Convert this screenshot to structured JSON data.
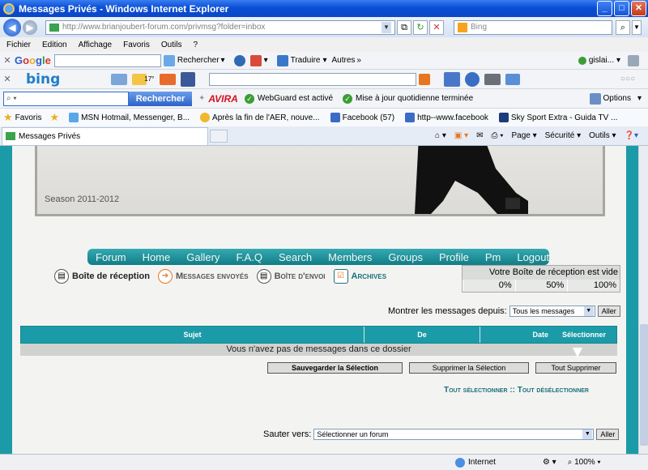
{
  "window": {
    "title": "Messages Privés - Windows Internet Explorer"
  },
  "address": {
    "url": "http://www.brianjoubert-forum.com/privmsg?folder=inbox",
    "search_placeholder": "Bing"
  },
  "menu": [
    "Fichier",
    "Edition",
    "Affichage",
    "Favoris",
    "Outils",
    "?"
  ],
  "google_toolbar": {
    "logo": "Google",
    "search_label": "Rechercher",
    "translate_label": "Traduire",
    "more_label": "Autres",
    "user": "gislai..."
  },
  "bing_toolbar": {
    "logo": "bing",
    "weather": "17°"
  },
  "avira_toolbar": {
    "search_button": "Rechercher",
    "brand": "AVIRA",
    "webguard": "WebGuard est activé",
    "update": "Mise à jour quotidienne terminée",
    "options": "Options"
  },
  "favorites": {
    "label": "Favoris",
    "items": [
      "MSN Hotmail, Messenger, B...",
      "Après la fin de l'AER, nouve...",
      "Facebook (57)",
      "http--www.facebook",
      "Sky Sport Extra - Guida TV ..."
    ]
  },
  "tab": {
    "title": "Messages Privés"
  },
  "commandbar": {
    "page": "Page",
    "securite": "Sécurité",
    "outils": "Outils"
  },
  "banner": {
    "season": "Season 2011-2012"
  },
  "nav": [
    "Forum",
    "Home",
    "Gallery",
    "F.A.Q",
    "Search",
    "Members",
    "Groups",
    "Profile",
    "Pm",
    "Logout"
  ],
  "mailtabs": {
    "inbox": "Boîte de réception",
    "sent": "Messages envoyés",
    "outbox": "Boîte d'envoi",
    "archives": "Archives"
  },
  "quota": {
    "text": "Votre Boîte de réception est vide",
    "p0": "0%",
    "p50": "50%",
    "p100": "100%",
    "fill_percent": 0
  },
  "filter": {
    "label": "Montrer les messages depuis:",
    "value": "Tous les messages",
    "button": "Aller"
  },
  "table": {
    "headers": {
      "subject": "Sujet",
      "from": "De",
      "date": "Date",
      "select": "Sélectionner"
    },
    "empty": "Vous n'avez pas de messages dans ce dossier"
  },
  "actions": {
    "save": "Sauvegarder la Sélection",
    "delete": "Supprimer la Sélection",
    "delete_all": "Tout Supprimer"
  },
  "select_links": {
    "select_all": "Tout sélectionner",
    "separator": "::",
    "deselect_all": "Tout désélectionner"
  },
  "jump": {
    "label": "Sauter vers:",
    "value": "Sélectionner un forum",
    "button": "Aller"
  },
  "status": {
    "zone": "Internet",
    "zoom": "100%"
  }
}
